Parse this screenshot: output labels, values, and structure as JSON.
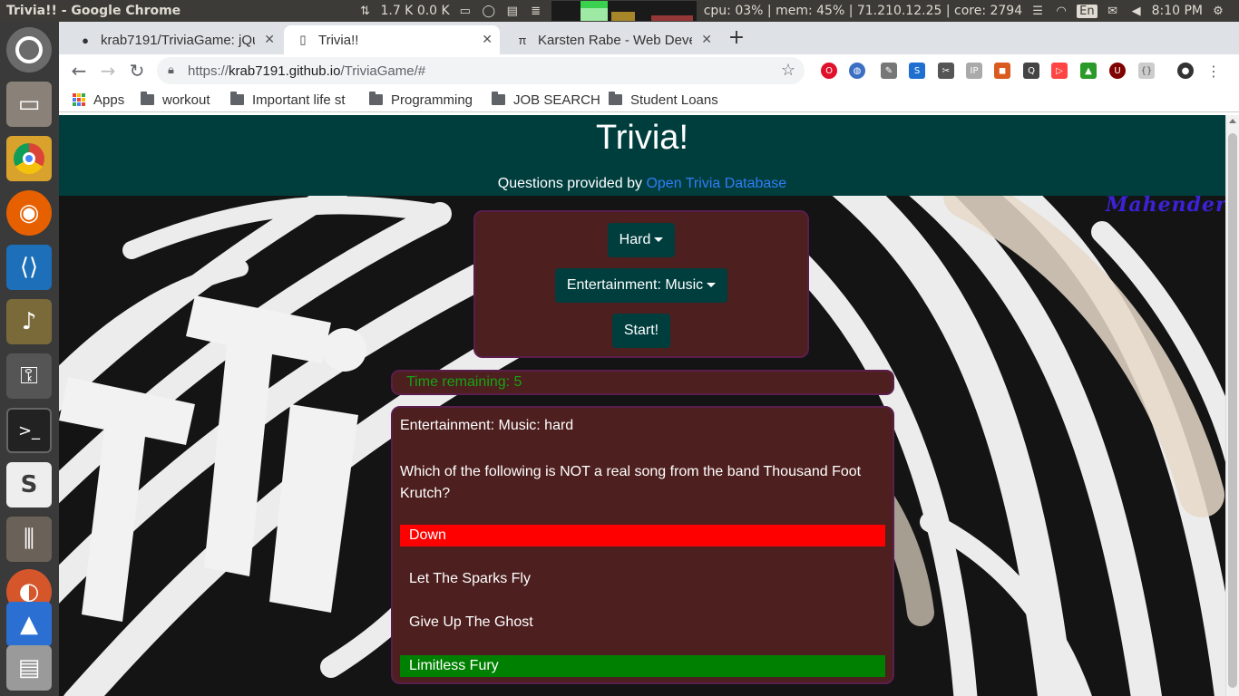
{
  "os": {
    "window_title": "Trivia!! - Google Chrome",
    "net_speed": "1.7 K 0.0 K",
    "sysinfo": "cpu: 03% | mem: 45% | 71.210.12.25 | core: 2794",
    "keyboard": "En",
    "clock": "8:10 PM"
  },
  "tabs": [
    {
      "title": "krab7191/TriviaGame: jQu",
      "icon": "github-icon"
    },
    {
      "title": "Trivia!!",
      "icon": "page-icon"
    },
    {
      "title": "Karsten Rabe - Web Devel",
      "icon": "pi-icon"
    }
  ],
  "address": {
    "scheme": "https://",
    "host": "krab7191.github.io",
    "path": "/TriviaGame/#"
  },
  "bookmarks": [
    "Apps",
    "workout",
    "Important life st",
    "Programming",
    "JOB SEARCH",
    "Student Loans"
  ],
  "page": {
    "title": "Trivia!",
    "provided_prefix": "Questions provided by",
    "provided_link": "Open Trivia Database",
    "signature": "Mahender",
    "difficulty": "Hard",
    "category": "Entertainment: Music",
    "start": "Start!",
    "timer": "Time remaining: 5",
    "question_category": "Entertainment: Music: hard",
    "question": "Which of the following is NOT a real song from the band Thousand Foot Krutch?",
    "answers": [
      {
        "text": "Down",
        "state": "wrong"
      },
      {
        "text": "Let The Sparks Fly",
        "state": "neutral"
      },
      {
        "text": "Give Up The Ghost",
        "state": "neutral"
      },
      {
        "text": "Limitless Fury",
        "state": "correct"
      }
    ]
  },
  "colors": {
    "header": "#003e3e",
    "panel": "#4e1f1f",
    "wrong": "#ff0000",
    "correct": "#008000",
    "timer_text": "#14a414"
  }
}
